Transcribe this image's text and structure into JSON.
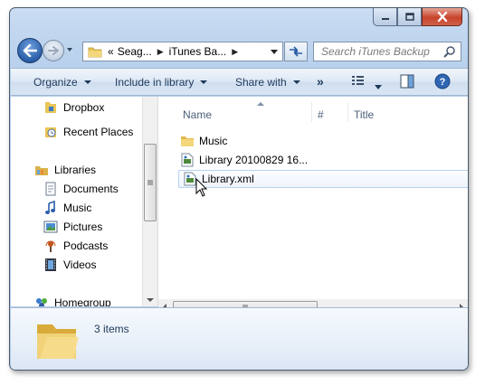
{
  "window": {
    "caption": {
      "minimize": "minimize",
      "maximize": "maximize",
      "close": "close"
    }
  },
  "address_bar": {
    "overflow": "«",
    "segments": [
      "Seag...",
      "iTunes Ba..."
    ],
    "separator": "▶"
  },
  "search": {
    "placeholder": "Search iTunes Backup"
  },
  "command_bar": {
    "organize": "Organize",
    "include_in_library": "Include in library",
    "share_with": "Share with",
    "more": "»"
  },
  "navigation_pane": {
    "items": [
      {
        "label": "Dropbox",
        "icon": "dropbox-icon"
      },
      {
        "label": "Recent Places",
        "icon": "recent-places-icon"
      },
      {
        "label": "Libraries",
        "icon": "libraries-icon"
      },
      {
        "label": "Documents",
        "icon": "documents-icon"
      },
      {
        "label": "Music",
        "icon": "music-icon"
      },
      {
        "label": "Pictures",
        "icon": "pictures-icon"
      },
      {
        "label": "Podcasts",
        "icon": "podcasts-icon"
      },
      {
        "label": "Videos",
        "icon": "videos-icon"
      },
      {
        "label": "Homegroup",
        "icon": "homegroup-icon"
      }
    ]
  },
  "file_list": {
    "columns": [
      "Name",
      "#",
      "Title"
    ],
    "rows": [
      {
        "name": "Music",
        "icon": "folder-icon"
      },
      {
        "name": "Library 20100829 16...",
        "icon": "xml-file-icon"
      },
      {
        "name": "Library.xml",
        "icon": "xml-file-icon"
      }
    ]
  },
  "details_pane": {
    "item_count": "3 items"
  },
  "colors": {
    "window_frame": "#b9d1ec",
    "command_bar": "#dde8f5",
    "text": "#1e395b",
    "folder": "#e8c557"
  }
}
